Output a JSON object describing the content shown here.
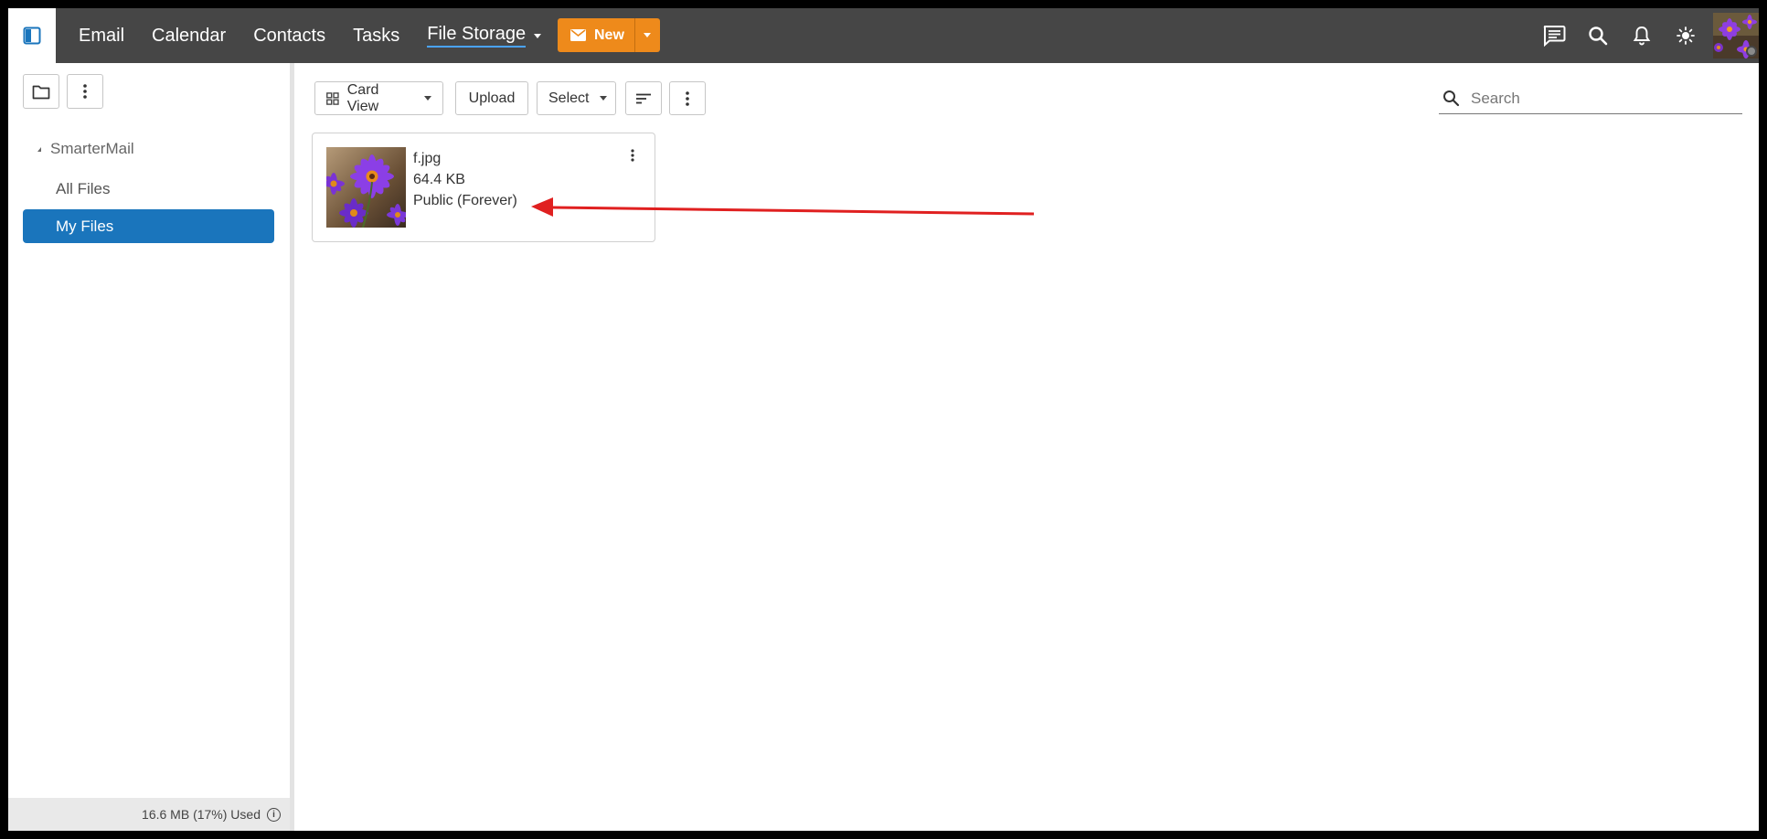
{
  "nav": {
    "items": [
      {
        "label": "Email"
      },
      {
        "label": "Calendar"
      },
      {
        "label": "Contacts"
      },
      {
        "label": "Tasks"
      },
      {
        "label": "File Storage"
      }
    ],
    "new_label": "New"
  },
  "sidebar": {
    "root_label": "SmarterMail",
    "items": [
      {
        "label": "All Files"
      },
      {
        "label": "My Files"
      }
    ],
    "storage_used": "16.6 MB (17%) Used"
  },
  "toolbar": {
    "view_label": "Card View",
    "upload_label": "Upload",
    "select_label": "Select"
  },
  "search": {
    "placeholder": "Search"
  },
  "files": [
    {
      "name": "f.jpg",
      "size": "64.4 KB",
      "sharing": "Public (Forever)"
    }
  ],
  "colors": {
    "topbar": "#464646",
    "accent_orange": "#ee8a1b",
    "selected_blue": "#1a75bc",
    "annotation_red": "#e02020"
  }
}
